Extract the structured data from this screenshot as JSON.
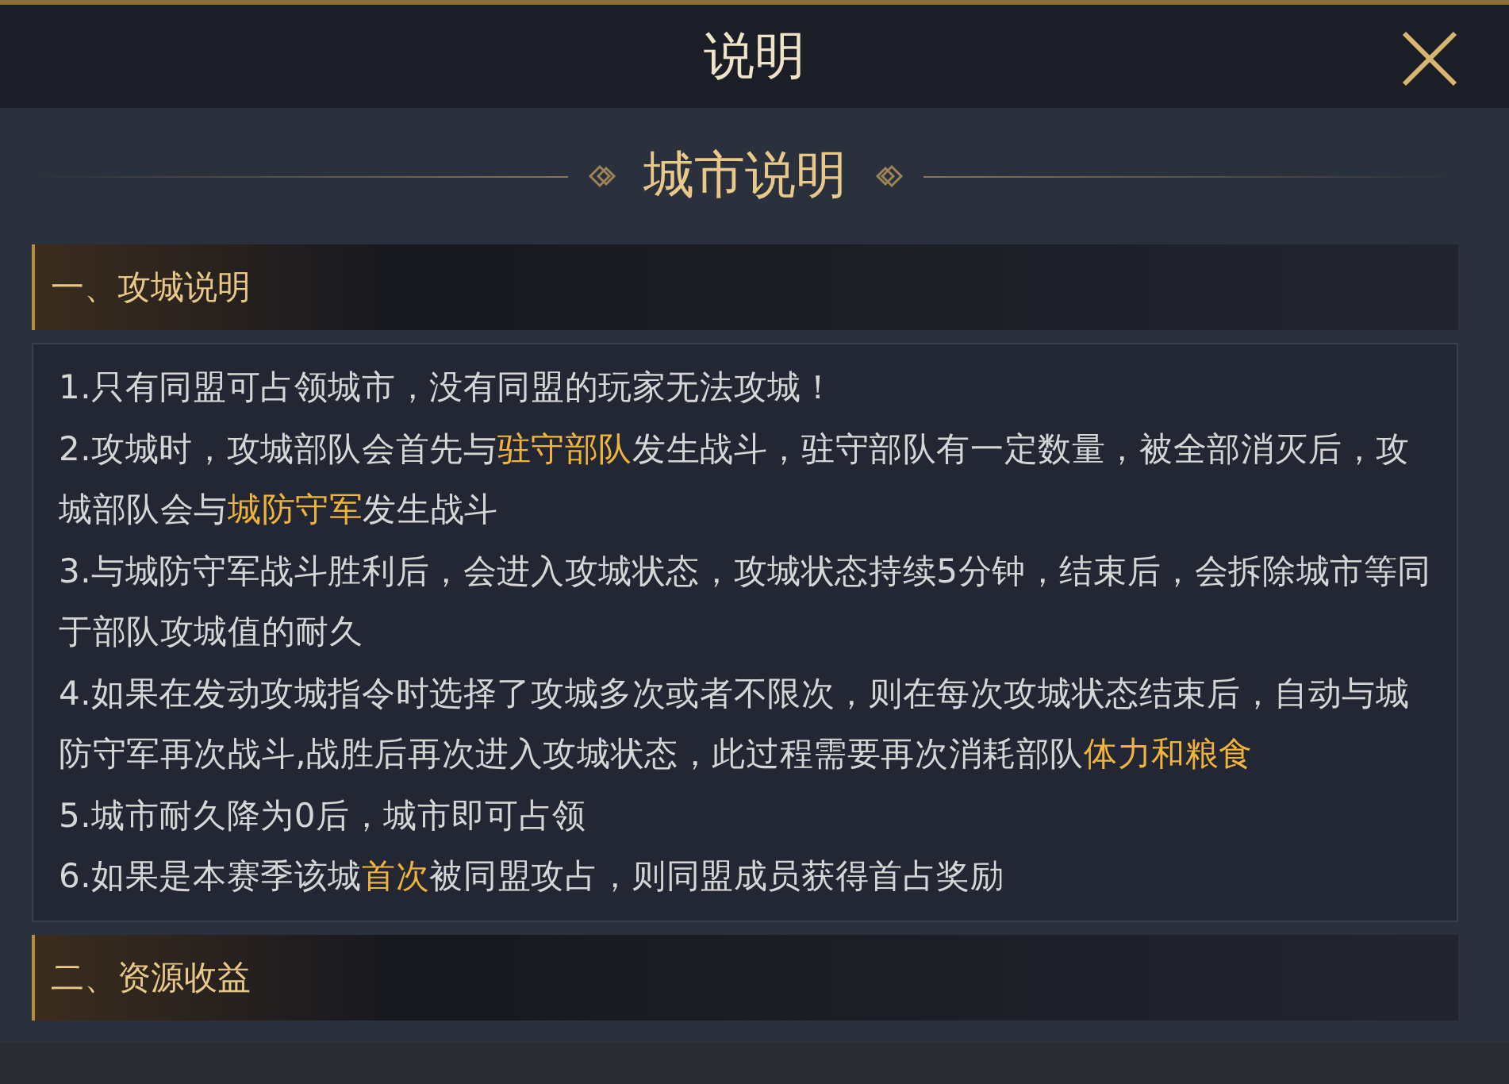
{
  "window": {
    "title": "说明"
  },
  "heading": "城市说明",
  "sections": [
    {
      "title": "一、攻城说明",
      "items": [
        "1.只有同盟可占领城市，没有同盟的玩家无法攻城！",
        "2.攻城时，攻城部队会首先与**驻守部队**发生战斗，驻守部队有一定数量，被全部消灭后，攻城部队会与**城防守军**发生战斗",
        "3.与城防守军战斗胜利后，会进入攻城状态，攻城状态持续5分钟，结束后，会拆除城市等同于部队攻城值的耐久",
        "4.如果在发动攻城指令时选择了攻城多次或者不限次，则在每次攻城状态结束后，自动与城防守军再次战斗,战胜后再次进入攻城状态，此过程需要再次消耗部队**体力和粮食**",
        "5.城市耐久降为0后，城市即可占领",
        "6.如果是本赛季该城**首次**被同盟攻占，则同盟成员获得首占奖励"
      ]
    },
    {
      "title": "二、资源收益"
    }
  ]
}
